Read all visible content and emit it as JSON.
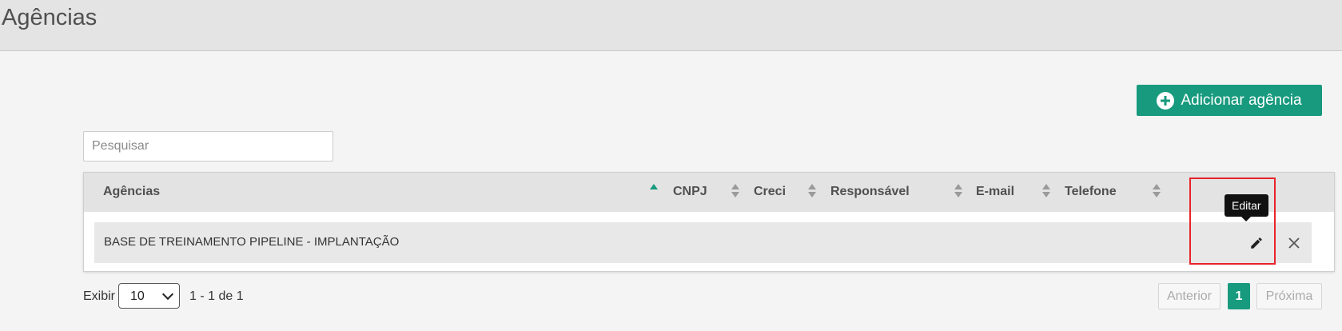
{
  "header": {
    "title": "Agências"
  },
  "toolbar": {
    "add_label": "Adicionar agência"
  },
  "search": {
    "placeholder": "Pesquisar",
    "value": ""
  },
  "table": {
    "columns": [
      "Agências",
      "CNPJ",
      "Creci",
      "Responsável",
      "E-mail",
      "Telefone"
    ],
    "sorted_column": "Agências",
    "sort_direction": "asc",
    "rows": [
      {
        "agencia": "BASE DE TREINAMENTO PIPELINE - IMPLANTAÇÃO",
        "cnpj": "",
        "creci": "",
        "responsavel": "",
        "email": "",
        "telefone": ""
      }
    ]
  },
  "tooltip": {
    "text": "Editar"
  },
  "footer": {
    "show_label": "Exibir",
    "page_size": "10",
    "page_size_options": [
      "10"
    ],
    "range_text": "1 - 1 de 1"
  },
  "pagination": {
    "prev_label": "Anterior",
    "current_page": "1",
    "next_label": "Próxima"
  },
  "colors": {
    "accent": "#179a7e",
    "highlight": "#e8242a",
    "header_bg": "#e4e4e4"
  },
  "icons": {
    "add": "plus-circle-icon",
    "edit": "pencil-icon",
    "delete": "close-icon"
  }
}
